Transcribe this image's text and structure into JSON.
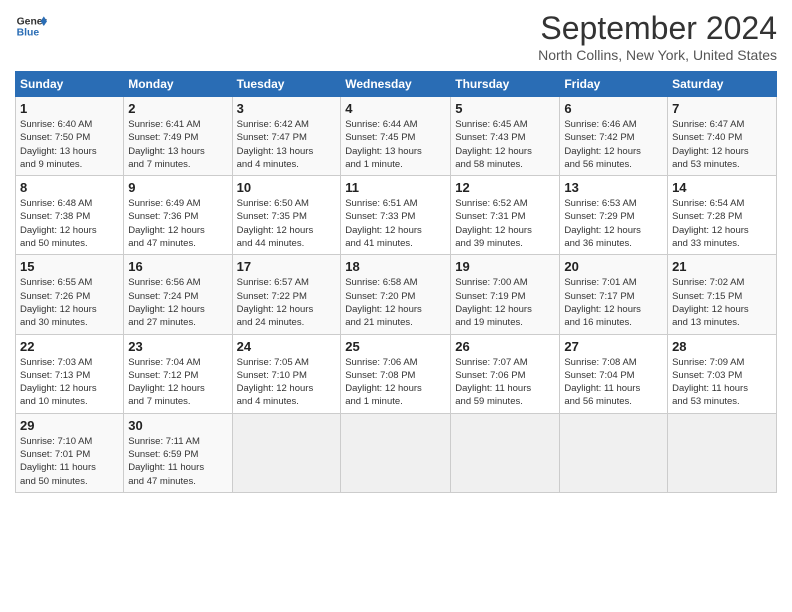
{
  "header": {
    "logo_general": "General",
    "logo_blue": "Blue",
    "title": "September 2024",
    "location": "North Collins, New York, United States"
  },
  "days_of_week": [
    "Sunday",
    "Monday",
    "Tuesday",
    "Wednesday",
    "Thursday",
    "Friday",
    "Saturday"
  ],
  "weeks": [
    [
      {
        "day": 1,
        "info": "Sunrise: 6:40 AM\nSunset: 7:50 PM\nDaylight: 13 hours\nand 9 minutes."
      },
      {
        "day": 2,
        "info": "Sunrise: 6:41 AM\nSunset: 7:49 PM\nDaylight: 13 hours\nand 7 minutes."
      },
      {
        "day": 3,
        "info": "Sunrise: 6:42 AM\nSunset: 7:47 PM\nDaylight: 13 hours\nand 4 minutes."
      },
      {
        "day": 4,
        "info": "Sunrise: 6:44 AM\nSunset: 7:45 PM\nDaylight: 13 hours\nand 1 minute."
      },
      {
        "day": 5,
        "info": "Sunrise: 6:45 AM\nSunset: 7:43 PM\nDaylight: 12 hours\nand 58 minutes."
      },
      {
        "day": 6,
        "info": "Sunrise: 6:46 AM\nSunset: 7:42 PM\nDaylight: 12 hours\nand 56 minutes."
      },
      {
        "day": 7,
        "info": "Sunrise: 6:47 AM\nSunset: 7:40 PM\nDaylight: 12 hours\nand 53 minutes."
      }
    ],
    [
      {
        "day": 8,
        "info": "Sunrise: 6:48 AM\nSunset: 7:38 PM\nDaylight: 12 hours\nand 50 minutes."
      },
      {
        "day": 9,
        "info": "Sunrise: 6:49 AM\nSunset: 7:36 PM\nDaylight: 12 hours\nand 47 minutes."
      },
      {
        "day": 10,
        "info": "Sunrise: 6:50 AM\nSunset: 7:35 PM\nDaylight: 12 hours\nand 44 minutes."
      },
      {
        "day": 11,
        "info": "Sunrise: 6:51 AM\nSunset: 7:33 PM\nDaylight: 12 hours\nand 41 minutes."
      },
      {
        "day": 12,
        "info": "Sunrise: 6:52 AM\nSunset: 7:31 PM\nDaylight: 12 hours\nand 39 minutes."
      },
      {
        "day": 13,
        "info": "Sunrise: 6:53 AM\nSunset: 7:29 PM\nDaylight: 12 hours\nand 36 minutes."
      },
      {
        "day": 14,
        "info": "Sunrise: 6:54 AM\nSunset: 7:28 PM\nDaylight: 12 hours\nand 33 minutes."
      }
    ],
    [
      {
        "day": 15,
        "info": "Sunrise: 6:55 AM\nSunset: 7:26 PM\nDaylight: 12 hours\nand 30 minutes."
      },
      {
        "day": 16,
        "info": "Sunrise: 6:56 AM\nSunset: 7:24 PM\nDaylight: 12 hours\nand 27 minutes."
      },
      {
        "day": 17,
        "info": "Sunrise: 6:57 AM\nSunset: 7:22 PM\nDaylight: 12 hours\nand 24 minutes."
      },
      {
        "day": 18,
        "info": "Sunrise: 6:58 AM\nSunset: 7:20 PM\nDaylight: 12 hours\nand 21 minutes."
      },
      {
        "day": 19,
        "info": "Sunrise: 7:00 AM\nSunset: 7:19 PM\nDaylight: 12 hours\nand 19 minutes."
      },
      {
        "day": 20,
        "info": "Sunrise: 7:01 AM\nSunset: 7:17 PM\nDaylight: 12 hours\nand 16 minutes."
      },
      {
        "day": 21,
        "info": "Sunrise: 7:02 AM\nSunset: 7:15 PM\nDaylight: 12 hours\nand 13 minutes."
      }
    ],
    [
      {
        "day": 22,
        "info": "Sunrise: 7:03 AM\nSunset: 7:13 PM\nDaylight: 12 hours\nand 10 minutes."
      },
      {
        "day": 23,
        "info": "Sunrise: 7:04 AM\nSunset: 7:12 PM\nDaylight: 12 hours\nand 7 minutes."
      },
      {
        "day": 24,
        "info": "Sunrise: 7:05 AM\nSunset: 7:10 PM\nDaylight: 12 hours\nand 4 minutes."
      },
      {
        "day": 25,
        "info": "Sunrise: 7:06 AM\nSunset: 7:08 PM\nDaylight: 12 hours\nand 1 minute."
      },
      {
        "day": 26,
        "info": "Sunrise: 7:07 AM\nSunset: 7:06 PM\nDaylight: 11 hours\nand 59 minutes."
      },
      {
        "day": 27,
        "info": "Sunrise: 7:08 AM\nSunset: 7:04 PM\nDaylight: 11 hours\nand 56 minutes."
      },
      {
        "day": 28,
        "info": "Sunrise: 7:09 AM\nSunset: 7:03 PM\nDaylight: 11 hours\nand 53 minutes."
      }
    ],
    [
      {
        "day": 29,
        "info": "Sunrise: 7:10 AM\nSunset: 7:01 PM\nDaylight: 11 hours\nand 50 minutes."
      },
      {
        "day": 30,
        "info": "Sunrise: 7:11 AM\nSunset: 6:59 PM\nDaylight: 11 hours\nand 47 minutes."
      },
      null,
      null,
      null,
      null,
      null
    ]
  ]
}
